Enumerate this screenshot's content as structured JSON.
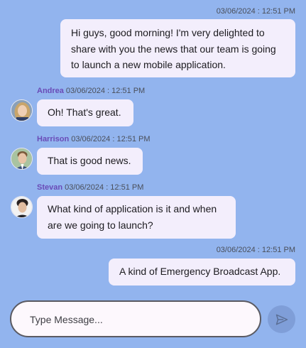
{
  "messages": [
    {
      "side": "outgoing",
      "timestamp": "03/06/2024 : 12:51 PM",
      "lines": [
        "Hi guys, good morning! I'm very delighted to",
        "share with you the news that our team is going",
        "to launch a new mobile application."
      ]
    },
    {
      "side": "incoming",
      "sender": "Andrea",
      "timestamp": "03/06/2024 : 12:51 PM",
      "lines": [
        "Oh! That's great."
      ],
      "avatar": "avatar-andrea"
    },
    {
      "side": "incoming",
      "sender": "Harrison",
      "timestamp": "03/06/2024 : 12:51 PM",
      "lines": [
        "That is good news."
      ],
      "avatar": "avatar-harrison"
    },
    {
      "side": "incoming",
      "sender": "Stevan",
      "timestamp": "03/06/2024 : 12:51 PM",
      "lines": [
        "What kind of application is it and when",
        "are we going to launch?"
      ],
      "avatar": "avatar-stevan"
    },
    {
      "side": "outgoing",
      "timestamp": "03/06/2024 : 12:51 PM",
      "lines": [
        "A kind of Emergency Broadcast App."
      ]
    }
  ],
  "composer": {
    "placeholder": "Type Message...",
    "send_icon": "send-icon"
  },
  "colors": {
    "background": "#92b4ee",
    "bubble": "#f3eefc",
    "sender_name": "#6a4bb7",
    "send_button": "#7f9ed8"
  }
}
